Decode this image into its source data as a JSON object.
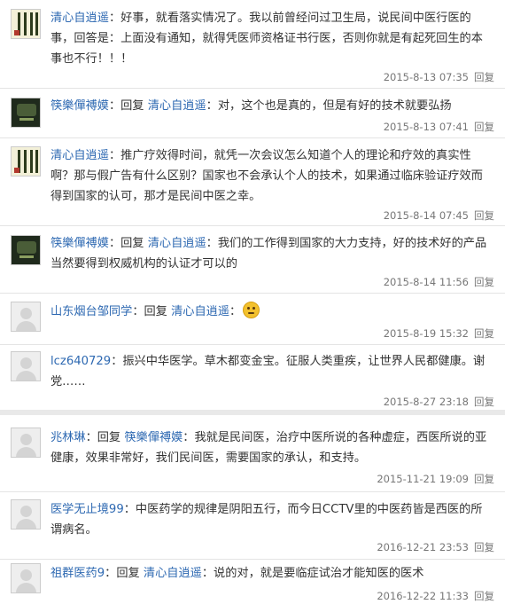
{
  "comments_top": [
    {
      "avatar": "calligraphy-avatar",
      "user": "清心自逍遥",
      "prefix": "",
      "reply_to": "",
      "body": "好事，就看落实情况了。我以前曾经问过卫生局，说民间中医行医的事，回答是：上面没有通知，就得凭医师资格证书行医，否则你就是有起死回生的本事也不行！！！",
      "time": "2015-8-13 07:35",
      "reply": "回复"
    },
    {
      "avatar": "dark-avatar",
      "user": "筷樂僤禣嫫",
      "prefix": "回复",
      "reply_to": "清心自逍遥",
      "body": "对，这个也是真的，但是有好的技术就要弘扬",
      "time": "2015-8-13 07:41",
      "reply": "回复"
    },
    {
      "avatar": "calligraphy-avatar",
      "user": "清心自逍遥",
      "prefix": "",
      "reply_to": "",
      "body": "推广疗效得时间，就凭一次会议怎么知道个人的理论和疗效的真实性啊？那与假广告有什么区别？国家也不会承认个人的技术，如果通过临床验证疗效而得到国家的认可，那才是民间中医之幸。",
      "time": "2015-8-14 07:45",
      "reply": "回复"
    },
    {
      "avatar": "dark-avatar",
      "user": "筷樂僤禣嫫",
      "prefix": "回复",
      "reply_to": "清心自逍遥",
      "body": "我们的工作得到国家的大力支持，好的技术好的产品当然要得到权威机构的认证才可以的",
      "time": "2015-8-14 11:56",
      "reply": "回复"
    },
    {
      "avatar": "default-avatar",
      "user": "山东烟台邹同学",
      "prefix": "回复",
      "reply_to": "清心自逍遥",
      "body": "",
      "emoji": "grimace-emoji",
      "time": "2015-8-19 15:32",
      "reply": "回复"
    },
    {
      "avatar": "default-avatar",
      "user": "lcz640729",
      "prefix": "",
      "reply_to": "",
      "body": "振兴中华医学。草木都变金宝。征服人类重疾，让世界人民都健康。谢党……",
      "time": "2015-8-27 23:18",
      "reply": "回复"
    }
  ],
  "comments_bottom": [
    {
      "avatar": "default-avatar",
      "user": "兆林琳",
      "prefix": "回复",
      "reply_to": "筷樂僤禣嫫",
      "body": "我就是民间医，治疗中医所说的各种虚症，西医所说的亚健康，效果非常好，我们民间医，需要国家的承认，和支持。",
      "time": "2015-11-21 19:09",
      "reply": "回复"
    },
    {
      "avatar": "default-avatar",
      "user": "医学无止境99",
      "prefix": "",
      "reply_to": "",
      "body": "中医药学的规律是阴阳五行，而今日CCTV里的中医药皆是西医的所谓病名。",
      "time": "2016-12-21 23:53",
      "reply": "回复"
    },
    {
      "avatar": "default-avatar",
      "user": "祖群医药9",
      "prefix": "回复",
      "reply_to": "清心自逍遥",
      "body": "说的对，就是要临症试治才能知医的医术",
      "time": "2016-12-22 11:33",
      "reply": "回复"
    }
  ],
  "colors": {
    "link": "#2e69b2",
    "text": "#333333",
    "meta": "#777777",
    "divider": "#e4e4e4"
  }
}
